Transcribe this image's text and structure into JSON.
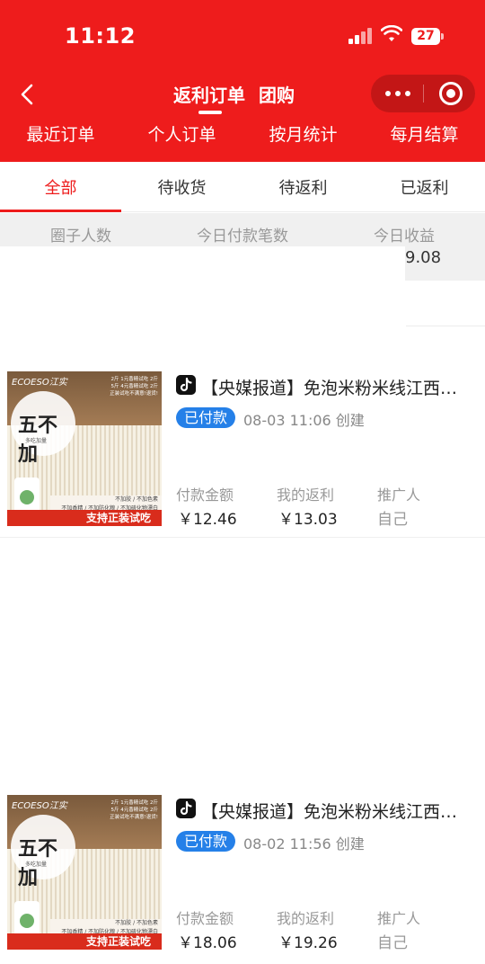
{
  "status_bar": {
    "time": "11:12",
    "battery": "27"
  },
  "header": {
    "title": "返利订单",
    "subtitle": "团购",
    "tabs": [
      {
        "label": "最近订单"
      },
      {
        "label": "个人订单"
      },
      {
        "label": "按月统计"
      },
      {
        "label": "每月结算"
      }
    ]
  },
  "status_tabs": [
    {
      "label": "全部",
      "active": true
    },
    {
      "label": "待收货",
      "active": false
    },
    {
      "label": "待返利",
      "active": false
    },
    {
      "label": "已返利",
      "active": false
    }
  ],
  "stats": {
    "labels": [
      "圈子人数",
      "今日付款笔数",
      "今日收益"
    ],
    "visible_value": "9.08"
  },
  "orders": [
    {
      "platform_icon": "douyin-icon",
      "title": "【央媒报道】免泡米粉米线江西…",
      "status": "已付款",
      "created": "08-03 11:06 创建",
      "pay_label": "付款金额",
      "pay_value": "￥12.46",
      "rebate_label": "我的返利",
      "rebate_value": "￥13.03",
      "promoter_label": "推广人",
      "promoter_value": "自己",
      "thumb": {
        "brand": "ECOESO江实",
        "promo": "2斤 1元香精试吃 2斤\n5斤 4元香精试吃 2斤\n正装试吃不满意!退货!",
        "seal": "五不加",
        "seal_sub": "多吃加量",
        "band": "不加胶 / 不加色素\n不加香精 / 不加防化粮 / 不加硫化物漂白",
        "cta": "支持正装试吃"
      }
    },
    {
      "platform_icon": "douyin-icon",
      "title": "【央媒报道】免泡米粉米线江西…",
      "status": "已付款",
      "created": "08-02 11:56 创建",
      "pay_label": "付款金额",
      "pay_value": "￥18.06",
      "rebate_label": "我的返利",
      "rebate_value": "￥19.26",
      "promoter_label": "推广人",
      "promoter_value": "自己",
      "thumb": {
        "brand": "ECOESO江实",
        "promo": "2斤 1元香精试吃 2斤\n5斤 4元香精试吃 2斤\n正装试吃不满意!退货!",
        "seal": "五不加",
        "seal_sub": "多吃加量",
        "band": "不加胶 / 不加色素\n不加香精 / 不加防化粮 / 不加硫化物漂白",
        "cta": "支持正装试吃"
      }
    }
  ],
  "colors": {
    "primary_red": "#ee1c1c",
    "badge_blue": "#2580e8"
  }
}
